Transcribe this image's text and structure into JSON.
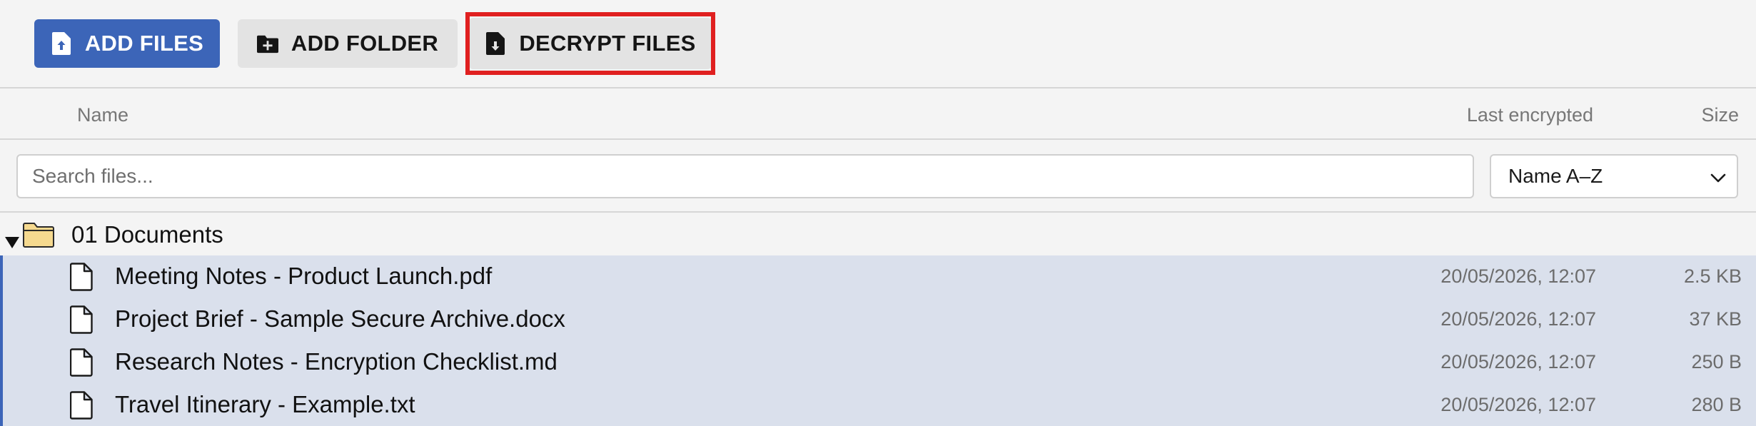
{
  "toolbar": {
    "add_files_label": "ADD FILES",
    "add_folder_label": "ADD FOLDER",
    "decrypt_files_label": "DECRYPT FILES",
    "icons": {
      "add_files": "file-upload-icon",
      "add_folder": "folder-plus-icon",
      "decrypt_files": "file-download-icon"
    },
    "colors": {
      "primary": "#3c65b8",
      "secondary": "#e3e3e3",
      "highlight": "#e02020"
    }
  },
  "columns": {
    "name": "Name",
    "last_encrypted": "Last encrypted",
    "size": "Size"
  },
  "search": {
    "placeholder": "Search files...",
    "value": ""
  },
  "sort": {
    "selected": "Name A–Z"
  },
  "folder": {
    "name": "01 Documents",
    "expanded": true
  },
  "files": [
    {
      "name": "Meeting Notes - Product Launch.pdf",
      "date": "20/05/2026, 12:07",
      "size": "2.5 KB"
    },
    {
      "name": "Project Brief - Sample Secure Archive.docx",
      "date": "20/05/2026, 12:07",
      "size": "37 KB"
    },
    {
      "name": "Research Notes - Encryption Checklist.md",
      "date": "20/05/2026, 12:07",
      "size": "250 B"
    },
    {
      "name": "Travel Itinerary - Example.txt",
      "date": "20/05/2026, 12:07",
      "size": "280 B"
    }
  ]
}
